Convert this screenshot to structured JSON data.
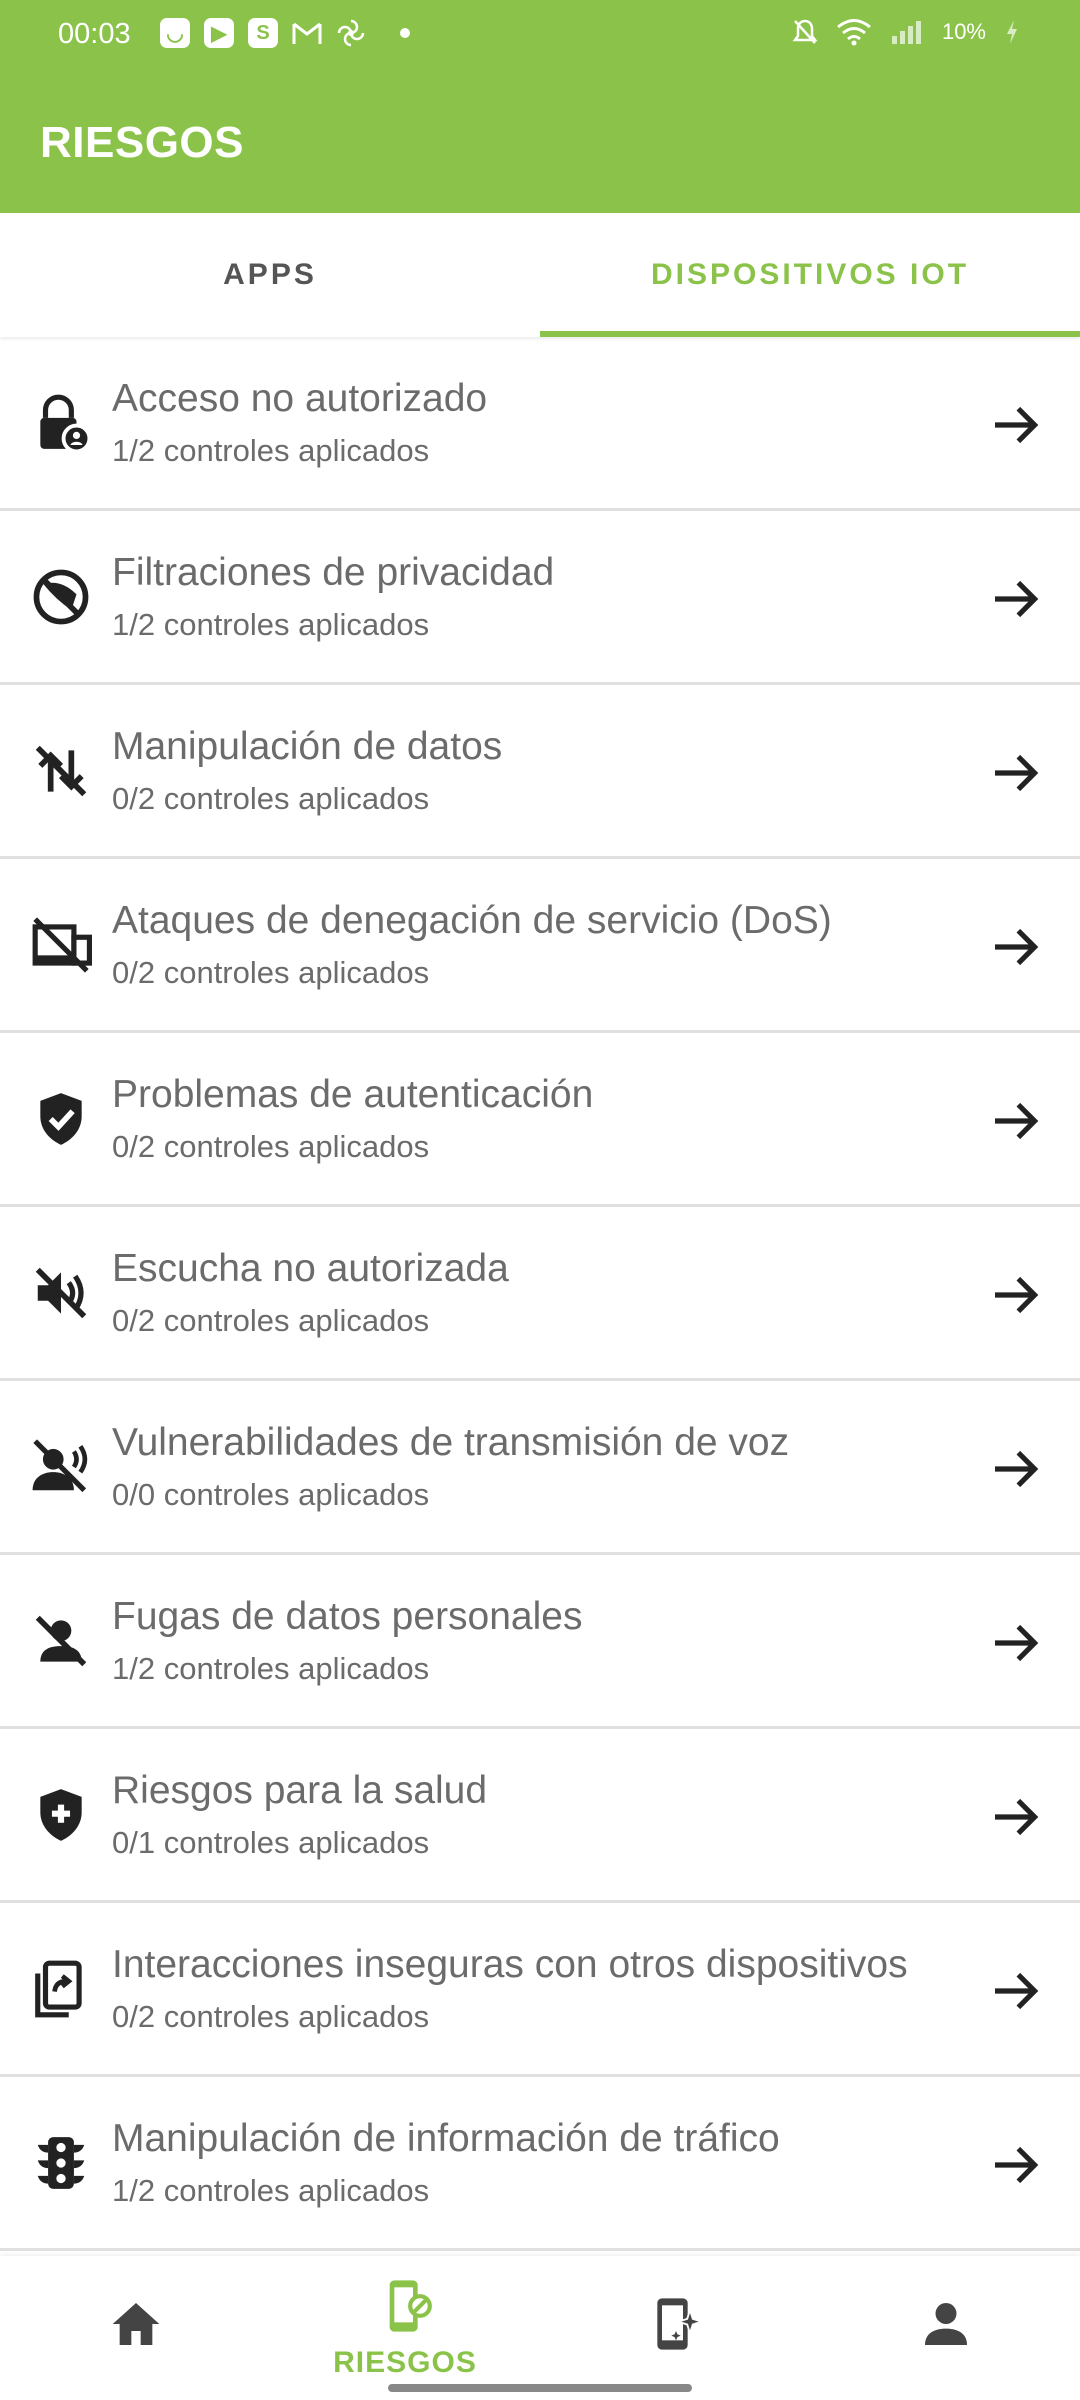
{
  "status_bar": {
    "time": "00:03",
    "battery": "10%"
  },
  "app_bar": {
    "title": "RIESGOS"
  },
  "tabs": [
    {
      "label": "APPS",
      "active": false
    },
    {
      "label": "DISPOSITIVOS IOT",
      "active": true
    }
  ],
  "risks": [
    {
      "title": "Acceso no autorizado",
      "subtitle": "1/2 controles aplicados",
      "icon": "lock-person-icon"
    },
    {
      "title": "Filtraciones de privacidad",
      "subtitle": "1/2 controles aplicados",
      "icon": "privacy-off-icon"
    },
    {
      "title": "Manipulación de datos",
      "subtitle": "0/2 controles aplicados",
      "icon": "sync-disabled-icon"
    },
    {
      "title": "Ataques de denegación de servicio (DoS)",
      "subtitle": "0/2 controles aplicados",
      "icon": "devices-off-icon"
    },
    {
      "title": "Problemas de autenticación",
      "subtitle": "0/2 controles aplicados",
      "icon": "verified-shield-icon"
    },
    {
      "title": "Escucha no autorizada",
      "subtitle": "0/2 controles aplicados",
      "icon": "volume-off-icon"
    },
    {
      "title": "Vulnerabilidades de transmisión de voz",
      "subtitle": "0/0 controles aplicados",
      "icon": "voice-over-off-icon"
    },
    {
      "title": "Fugas de datos personales",
      "subtitle": "1/2 controles aplicados",
      "icon": "person-off-icon"
    },
    {
      "title": "Riesgos para la salud",
      "subtitle": "0/1 controles aplicados",
      "icon": "health-shield-icon"
    },
    {
      "title": "Interacciones inseguras con otros dispositivos",
      "subtitle": "0/2 controles aplicados",
      "icon": "phonelink-share-icon"
    },
    {
      "title": "Manipulación de información de tráfico",
      "subtitle": "1/2 controles aplicados",
      "icon": "traffic-light-icon"
    }
  ],
  "bottom_nav": [
    {
      "icon": "home-icon",
      "label": ""
    },
    {
      "icon": "device-blocked-icon",
      "label": "RIESGOS",
      "active": true
    },
    {
      "icon": "device-sparkle-icon",
      "label": ""
    },
    {
      "icon": "person-icon",
      "label": ""
    }
  ],
  "colors": {
    "primary": "#8bc34a",
    "text": "#6b6b6b",
    "icon": "#222222"
  }
}
